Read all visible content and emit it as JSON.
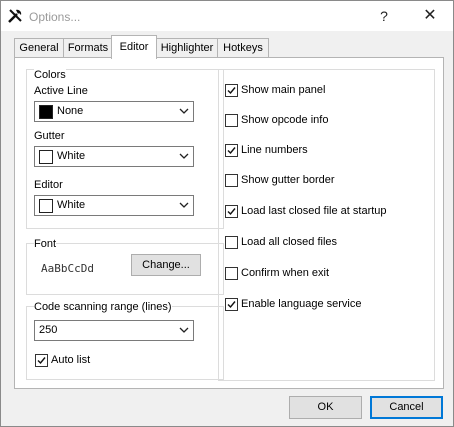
{
  "window": {
    "title": "Options..."
  },
  "tabs": [
    {
      "label": "General"
    },
    {
      "label": "Formats"
    },
    {
      "label": "Editor"
    },
    {
      "label": "Highlighter"
    },
    {
      "label": "Hotkeys"
    }
  ],
  "colors": {
    "group_label": "Colors",
    "active_line": {
      "label": "Active Line",
      "value": "None",
      "swatch": "#000000"
    },
    "gutter": {
      "label": "Gutter",
      "value": "White",
      "swatch": "#ffffff"
    },
    "editor": {
      "label": "Editor",
      "value": "White",
      "swatch": "#ffffff"
    }
  },
  "font": {
    "group_label": "Font",
    "sample": "AaBbCcDd",
    "change_label": "Change..."
  },
  "scanning": {
    "group_label": "Code scanning range (lines)",
    "value": "250",
    "auto_list_label": "Auto list",
    "auto_list_checked": true
  },
  "options": [
    {
      "label": "Show main panel",
      "checked": true
    },
    {
      "label": "Show opcode info",
      "checked": false
    },
    {
      "label": "Line numbers",
      "checked": true
    },
    {
      "label": "Show gutter border",
      "checked": false
    },
    {
      "label": "Load last closed file at startup",
      "checked": true
    },
    {
      "label": "Load all closed files",
      "checked": false
    },
    {
      "label": "Confirm when exit",
      "checked": false
    },
    {
      "label": "Enable language service",
      "checked": true
    }
  ],
  "footer": {
    "ok_label": "OK",
    "cancel_label": "Cancel"
  }
}
